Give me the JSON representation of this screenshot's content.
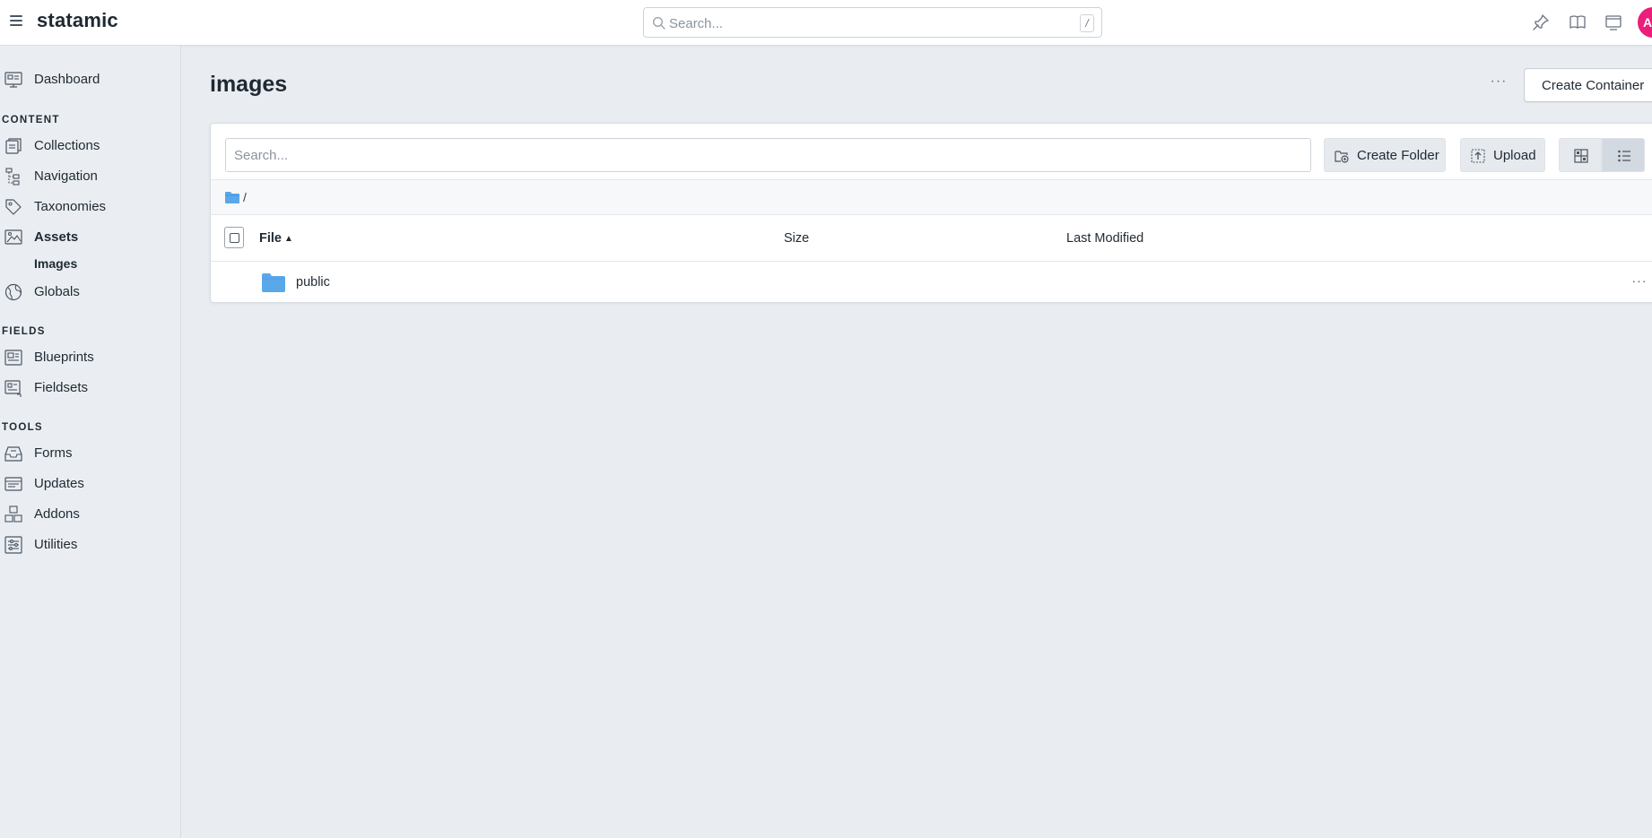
{
  "topbar": {
    "logo": "statamic",
    "search_placeholder": "Search...",
    "search_shortcut": "/",
    "avatar_initial": "A",
    "avatar_color": "#ec1e79"
  },
  "sidebar": {
    "dashboard": "Dashboard",
    "sections": {
      "content": "CONTENT",
      "fields": "FIELDS",
      "tools": "TOOLS"
    },
    "items": {
      "collections": "Collections",
      "navigation": "Navigation",
      "taxonomies": "Taxonomies",
      "assets": "Assets",
      "images": "Images",
      "globals": "Globals",
      "blueprints": "Blueprints",
      "fieldsets": "Fieldsets",
      "forms": "Forms",
      "updates": "Updates",
      "addons": "Addons",
      "utilities": "Utilities"
    }
  },
  "main": {
    "title": "images",
    "more_label": "···",
    "create_container_label": "Create Container",
    "browser": {
      "search_placeholder": "Search...",
      "create_folder_label": "Create Folder",
      "upload_label": "Upload",
      "active_view": "list",
      "breadcrumb_path": "/",
      "columns": {
        "file": "File",
        "size": "Size",
        "last_modified": "Last Modified"
      },
      "sort_indicator": "▲",
      "rows": [
        {
          "name": "public",
          "type": "folder",
          "size": "",
          "last_modified": "",
          "actions_label": "···"
        }
      ]
    }
  },
  "colors": {
    "accent_folder": "#5aa7ea",
    "avatar": "#ec1e79",
    "background": "#e9edf1"
  }
}
